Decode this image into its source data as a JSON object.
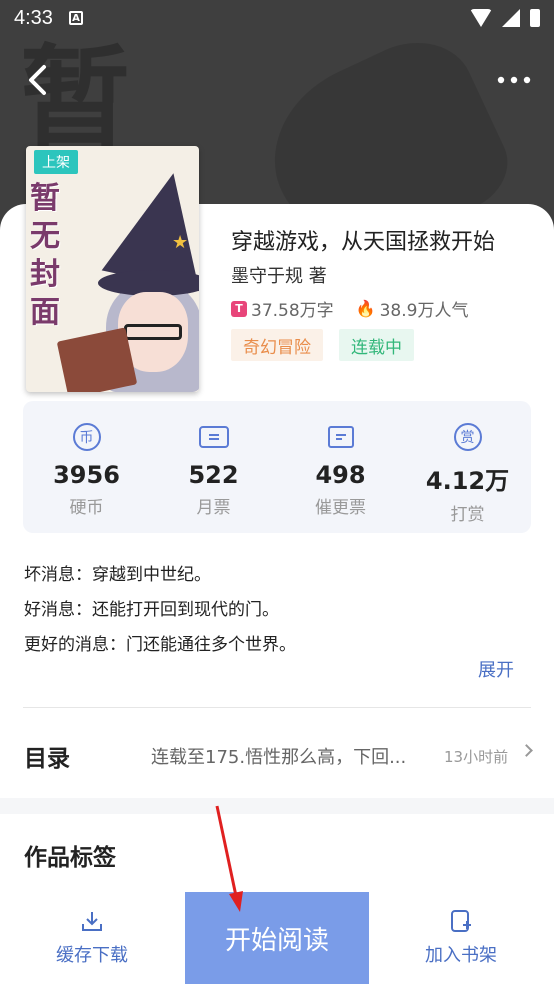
{
  "status_bar": {
    "time": "4:33",
    "notif_icon_letter": "A"
  },
  "cover": {
    "badge": "上架",
    "placeholder_text": "暂无封面"
  },
  "book": {
    "title": "穿越游戏，从天国拯救开始",
    "author": "墨守于规  著",
    "word_count": "37.58万字",
    "popularity": "38.9万人气",
    "genre": "奇幻冒险",
    "status": "连载中"
  },
  "stats": [
    {
      "icon": "coin-icon",
      "glyph": "币",
      "value": "3956",
      "label": "硬币"
    },
    {
      "icon": "ticket-icon",
      "glyph": "",
      "value": "522",
      "label": "月票"
    },
    {
      "icon": "screen-icon",
      "glyph": "",
      "value": "498",
      "label": "催更票"
    },
    {
      "icon": "reward-icon",
      "glyph": "赏",
      "value": "4.12万",
      "label": "打赏"
    }
  ],
  "synopsis": [
    "坏消息：穿越到中世纪。",
    "好消息：还能打开回到现代的门。",
    "更好的消息：门还能通往多个世界。"
  ],
  "expand_label": "展开",
  "catalog": {
    "label": "目录",
    "latest": "连载至175.悟性那么高，下回...",
    "updated": "13小时前"
  },
  "tags_heading": "作品标签",
  "bottom_bar": {
    "download_label": "缓存下载",
    "read_label": "开始阅读",
    "shelf_label": "加入书架"
  },
  "colors": {
    "accent": "#4a6fc4",
    "read_button": "#7a9ce8",
    "annotation_arrow": "#e02020"
  }
}
